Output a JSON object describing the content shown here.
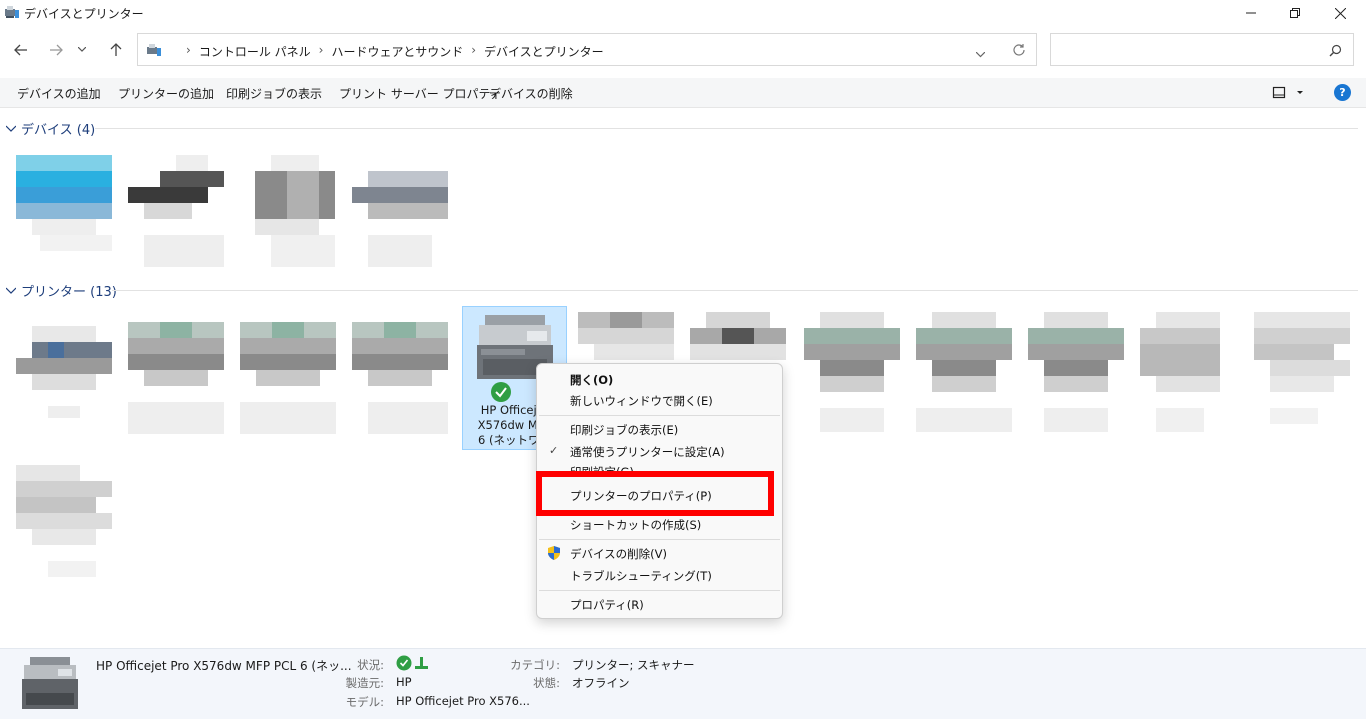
{
  "window": {
    "title": "デバイスとプリンター"
  },
  "address": {
    "breadcrumbs": [
      "コントロール パネル",
      "ハードウェアとサウンド",
      "デバイスとプリンター"
    ],
    "search_placeholder": ""
  },
  "toolbar": {
    "items": [
      "デバイスの追加",
      "プリンターの追加",
      "印刷ジョブの表示",
      "プリント サーバー プロパティ",
      "デバイスの削除"
    ]
  },
  "sections": {
    "devices": {
      "label": "デバイス (4)"
    },
    "printers": {
      "label": "プリンター (13)"
    }
  },
  "selected_printer": {
    "label_lines": [
      "HP Officejet",
      "X576dw MFP",
      "6 (ネットワー"
    ]
  },
  "context_menu": {
    "items": [
      {
        "label": "開く(O)",
        "bold": true
      },
      {
        "label": "新しいウィンドウで開く(E)"
      },
      {
        "label": "印刷ジョブの表示(E)"
      },
      {
        "label": "通常使うプリンターに設定(A)",
        "checked": true
      },
      {
        "label": "印刷設定(G)"
      },
      {
        "label": "プリンターのプロパティ(P)",
        "highlighted": true
      },
      {
        "label": "ショートカットの作成(S)"
      },
      {
        "label": "デバイスの削除(V)",
        "shield": true
      },
      {
        "label": "トラブルシューティング(T)"
      },
      {
        "label": "プロパティ(R)"
      }
    ]
  },
  "details": {
    "name": "HP Officejet Pro X576dw MFP PCL 6 (ネッ...",
    "status_key": "状況:",
    "maker_key": "製造元:",
    "maker_val": "HP",
    "model_key": "モデル:",
    "model_val": "HP Officejet Pro X576...",
    "category_key": "カテゴリ:",
    "category_val": "プリンター; スキャナー",
    "state_key": "状態:",
    "state_val": "オフライン"
  },
  "colors": {
    "accent": "#1e3e7b",
    "highlight_box": "#ff0000",
    "selection": "#cce8ff"
  }
}
